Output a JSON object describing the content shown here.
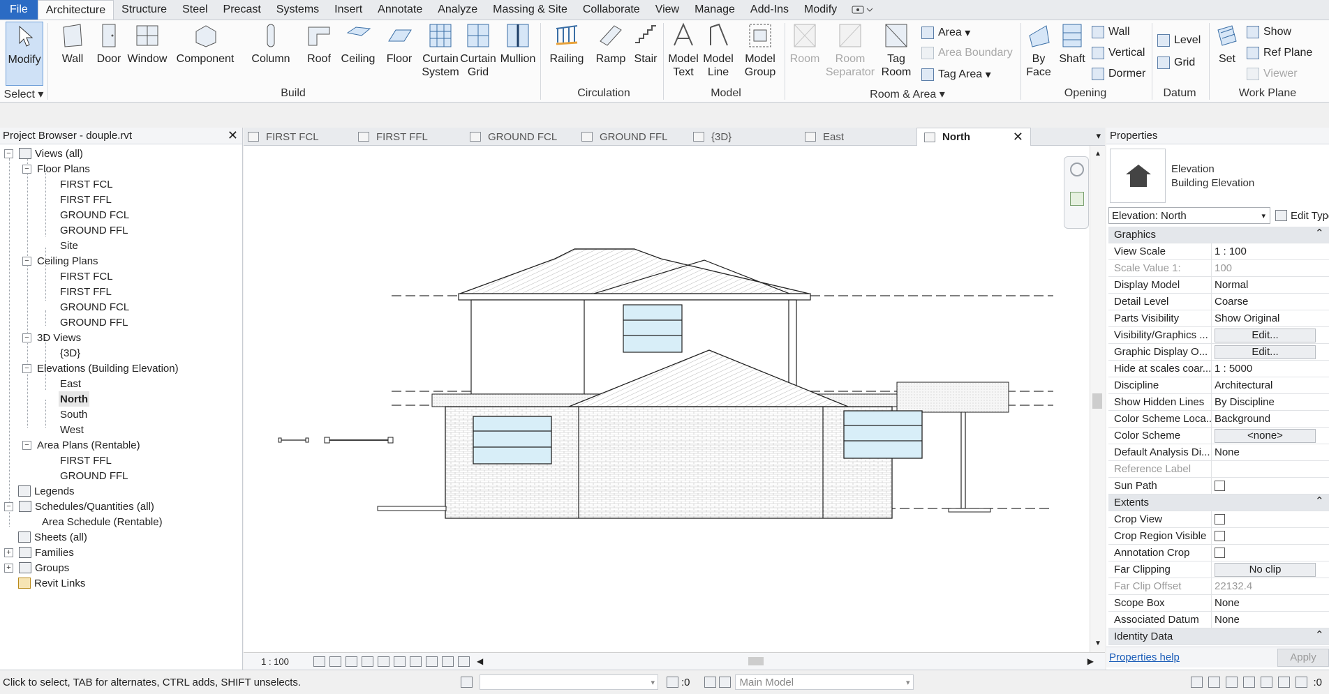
{
  "menu": {
    "file": "File",
    "tabs": [
      "Architecture",
      "Structure",
      "Steel",
      "Precast",
      "Systems",
      "Insert",
      "Annotate",
      "Analyze",
      "Massing & Site",
      "Collaborate",
      "View",
      "Manage",
      "Add-Ins",
      "Modify"
    ]
  },
  "ribbon": {
    "select": {
      "modify": "Modify",
      "label": "Select"
    },
    "build": {
      "label": "Build",
      "wall": "Wall",
      "door": "Door",
      "window": "Window",
      "component": "Component",
      "column": "Column",
      "roof": "Roof",
      "ceiling": "Ceiling",
      "floor": "Floor",
      "curtain_system_1": "Curtain",
      "curtain_system_2": "System",
      "curtain_grid_1": "Curtain",
      "curtain_grid_2": "Grid",
      "mullion": "Mullion"
    },
    "circulation": {
      "label": "Circulation",
      "railing": "Railing",
      "ramp": "Ramp",
      "stair": "Stair"
    },
    "model": {
      "label": "Model",
      "model_text_1": "Model",
      "model_text_2": "Text",
      "model_line_1": "Model",
      "model_line_2": "Line",
      "model_group_1": "Model",
      "model_group_2": "Group"
    },
    "room_area": {
      "label": "Room & Area",
      "room": "Room",
      "room_sep_1": "Room",
      "room_sep_2": "Separator",
      "tag_room_1": "Tag",
      "tag_room_2": "Room",
      "area": "Area",
      "area_boundary": "Area  Boundary",
      "tag_area": "Tag  Area"
    },
    "opening": {
      "label": "Opening",
      "by_face_1": "By",
      "by_face_2": "Face",
      "shaft": "Shaft",
      "wall": "Wall",
      "vertical": "Vertical",
      "dormer": "Dormer"
    },
    "datum": {
      "label": "Datum",
      "level": "Level",
      "grid": "Grid"
    },
    "work_plane": {
      "label": "Work Plane",
      "set": "Set",
      "show": "Show",
      "ref_plane": "Ref  Plane",
      "viewer": "Viewer"
    }
  },
  "project_browser": {
    "title": "Project Browser - douple.rvt",
    "tree": {
      "views_all": "Views (all)",
      "floor_plans": "Floor Plans",
      "fp_items": [
        "FIRST FCL",
        "FIRST FFL",
        "GROUND FCL",
        "GROUND FFL",
        "Site"
      ],
      "ceiling_plans": "Ceiling Plans",
      "cp_items": [
        "FIRST FCL",
        "FIRST FFL",
        "GROUND FCL",
        "GROUND FFL"
      ],
      "views_3d": "3D Views",
      "v3d_items": [
        "{3D}"
      ],
      "elevations": "Elevations (Building Elevation)",
      "elev_items": [
        "East",
        "North",
        "South",
        "West"
      ],
      "area_plans": "Area Plans (Rentable)",
      "ap_items": [
        "FIRST FFL",
        "GROUND FFL"
      ],
      "legends": "Legends",
      "schedules": "Schedules/Quantities (all)",
      "schedule_item": "Area Schedule (Rentable)",
      "sheets": "Sheets (all)",
      "families": "Families",
      "groups": "Groups",
      "revit_links": "Revit Links"
    }
  },
  "view_tabs": [
    "FIRST FCL",
    "FIRST FFL",
    "GROUND FCL",
    "GROUND FFL",
    "{3D}",
    "East",
    "North"
  ],
  "view_control": {
    "scale": "1 : 100"
  },
  "properties": {
    "title": "Properties",
    "type_line1": "Elevation",
    "type_line2": "Building Elevation",
    "instance": "Elevation: North",
    "edit_type": "Edit Type",
    "groups": {
      "graphics": "Graphics",
      "extents": "Extents",
      "identity": "Identity Data"
    },
    "graphics_rows": [
      {
        "k": "View Scale",
        "v": "1 : 100"
      },
      {
        "k": "Scale Value    1:",
        "v": "100"
      },
      {
        "k": "Display Model",
        "v": "Normal"
      },
      {
        "k": "Detail Level",
        "v": "Coarse"
      },
      {
        "k": "Parts Visibility",
        "v": "Show Original"
      },
      {
        "k": "Visibility/Graphics ...",
        "v": "Edit..."
      },
      {
        "k": "Graphic Display O...",
        "v": "Edit..."
      },
      {
        "k": "Hide at scales coar...",
        "v": "1 : 5000"
      },
      {
        "k": "Discipline",
        "v": "Architectural"
      },
      {
        "k": "Show Hidden Lines",
        "v": "By Discipline"
      },
      {
        "k": "Color Scheme Loca...",
        "v": "Background"
      },
      {
        "k": "Color Scheme",
        "v": "<none>"
      },
      {
        "k": "Default Analysis Di...",
        "v": "None"
      },
      {
        "k": "Reference Label",
        "v": ""
      },
      {
        "k": "Sun Path",
        "v": ""
      }
    ],
    "extents_rows": [
      {
        "k": "Crop View",
        "v": ""
      },
      {
        "k": "Crop Region Visible",
        "v": ""
      },
      {
        "k": "Annotation Crop",
        "v": ""
      },
      {
        "k": "Far Clipping",
        "v": "No clip"
      },
      {
        "k": "Far Clip Offset",
        "v": "22132.4"
      },
      {
        "k": "Scope Box",
        "v": "None"
      },
      {
        "k": "Associated Datum",
        "v": "None"
      }
    ],
    "help": "Properties help",
    "apply": "Apply"
  },
  "status": {
    "message": "Click to select, TAB for alternates, CTRL adds, SHIFT unselects.",
    "count": ":0",
    "model": "Main Model",
    "filter_count": ":0"
  }
}
